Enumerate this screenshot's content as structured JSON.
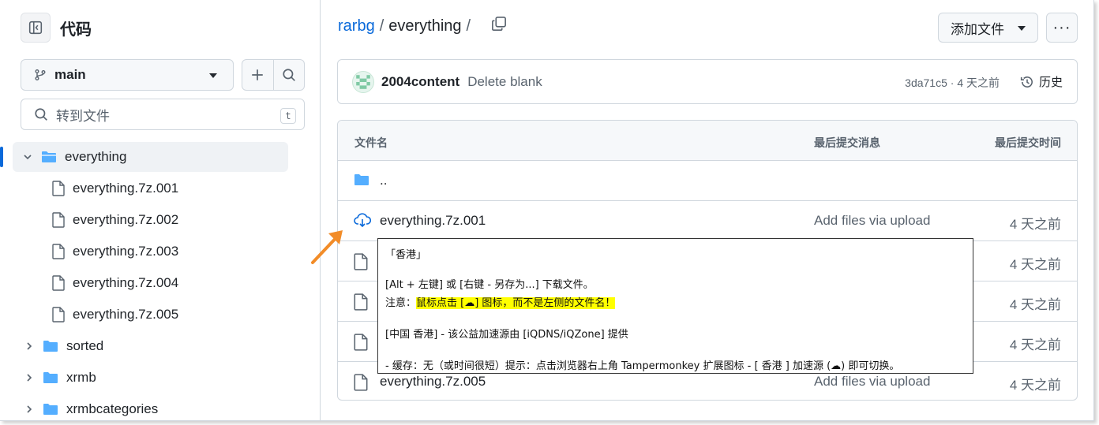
{
  "sidebar": {
    "title": "代码",
    "branch": "main",
    "goto_placeholder": "转到文件",
    "goto_shortcut": "t",
    "tree": [
      {
        "label": "everything",
        "type": "folder",
        "expanded": true,
        "active": true
      },
      {
        "label": "everything.7z.001",
        "type": "file"
      },
      {
        "label": "everything.7z.002",
        "type": "file"
      },
      {
        "label": "everything.7z.003",
        "type": "file"
      },
      {
        "label": "everything.7z.004",
        "type": "file"
      },
      {
        "label": "everything.7z.005",
        "type": "file"
      },
      {
        "label": "sorted",
        "type": "folder"
      },
      {
        "label": "xrmb",
        "type": "folder"
      },
      {
        "label": "xrmbcategories",
        "type": "folder"
      }
    ]
  },
  "header": {
    "breadcrumb_repo": "rarbg",
    "breadcrumb_sep": "/",
    "breadcrumb_folder": "everything",
    "breadcrumb_trailing_sep": "/",
    "add_file_label": "添加文件",
    "more_label": "···"
  },
  "commit": {
    "author": "2004content",
    "message": "Delete blank",
    "meta": "3da71c5 · 4 天之前",
    "history_label": "历史"
  },
  "table": {
    "col_name": "文件名",
    "col_message": "最后提交消息",
    "col_time": "最后提交时间",
    "rows": [
      {
        "name": "..",
        "type": "parent",
        "message": "",
        "time": ""
      },
      {
        "name": "everything.7z.001",
        "type": "file-cloud",
        "message": "Add files via upload",
        "time": "4 天之前"
      },
      {
        "name": "",
        "type": "file",
        "message": "",
        "time": "4 天之前"
      },
      {
        "name": "",
        "type": "file",
        "message": "",
        "time": "4 天之前"
      },
      {
        "name": "",
        "type": "file",
        "message": "",
        "time": "4 天之前"
      },
      {
        "name": "everything.7z.005",
        "type": "file",
        "message": "Add files via upload",
        "time": "4 天之前"
      }
    ]
  },
  "popup": {
    "line1": "「香港」",
    "line2": "[Alt + 左键] 或 [右键 - 另存为...] 下载文件。",
    "line3_prefix": "注意：",
    "line3_highlight": "鼠标点击 [☁] 图标，而不是左侧的文件名！",
    "line4": "[中国 香港] - 该公益加速源由 [iQDNS/iQZone] 提供",
    "line5": "- 缓存：无（或时间很短）提示：点击浏览器右上角 Tampermonkey 扩展图标 - [ 香港 ] 加速源 (☁) 即可切换。"
  },
  "colors": {
    "accent": "#0969da",
    "folder": "#54aeff",
    "arrow": "#f28c28",
    "highlight": "#ffff00"
  }
}
